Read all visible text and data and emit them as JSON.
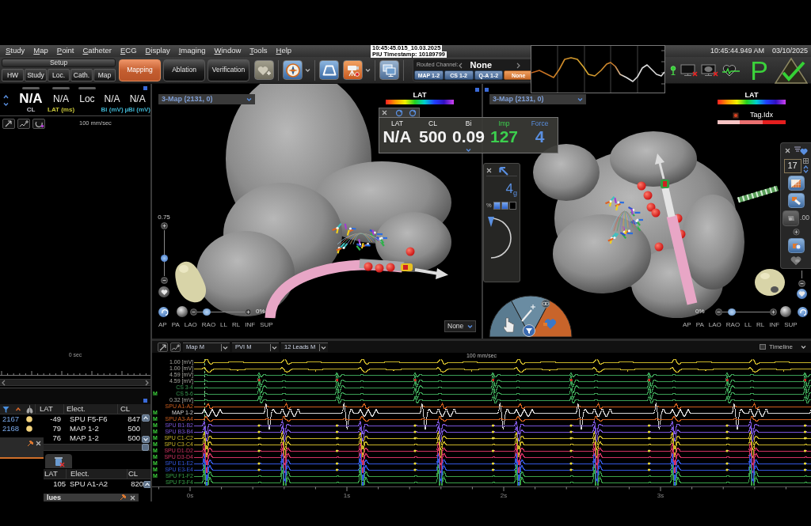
{
  "menu_bar": {
    "items": [
      "Study",
      "Map",
      "Point",
      "Catheter",
      "ECG",
      "Display",
      "Imaging",
      "Window",
      "Tools",
      "Help"
    ],
    "time": "10:45:44.949 AM",
    "date": "03/10/2025"
  },
  "timestamp_overlay": {
    "lines": [
      "10:45:45.015_10.03.2025",
      "PIU Timestamp: 10189799"
    ]
  },
  "toolbar": {
    "setup": {
      "label": "Setup",
      "buttons": [
        "HW",
        "Study",
        "Loc.",
        "Cath.",
        "Map"
      ]
    },
    "modes": [
      {
        "label": "Mapping",
        "selected": true
      },
      {
        "label": "Ablation",
        "selected": false
      },
      {
        "label": "Verification",
        "selected": false
      }
    ],
    "favorite_button": {
      "disabled": true
    },
    "routed_channel": {
      "label": "Routed Channel:",
      "value": "None",
      "channels": [
        {
          "label": "MAP 1-2",
          "selected": false
        },
        {
          "label": "CS 1-2",
          "selected": false
        },
        {
          "label": "Q-A 1-2",
          "selected": false
        },
        {
          "label": "None",
          "selected": true
        }
      ]
    },
    "status_letter": "P"
  },
  "left_panel": {
    "readouts": [
      {
        "kind": "main",
        "bar": true,
        "value": "N/A",
        "caption": "CL",
        "color": "#c9c9d2"
      },
      {
        "kind": "small",
        "bar": true,
        "value": "N/A",
        "caption": "LAT (ms)",
        "color": "#c6c43a"
      },
      {
        "kind": "small",
        "bar": true,
        "value": "Loc"
      },
      {
        "kind": "small",
        "bar": false,
        "value": "N/A",
        "caption": "Bi (mV)",
        "color": "#3fb3cf"
      },
      {
        "kind": "small",
        "bar": false,
        "value": "N/A",
        "caption": "µBi (mV)",
        "color": "#3fb3cf"
      }
    ],
    "speed": "100 mm/sec",
    "time_label": "0 sec"
  },
  "points_table": {
    "columns": [
      "LAT",
      "Elect.",
      "CL"
    ],
    "rows": [
      {
        "id": "2167",
        "color": "#f2d27c",
        "lat": "-49",
        "electrode": "SPU F5-F6",
        "cl": "847"
      },
      {
        "id": "2168",
        "color": "#f2d27c",
        "lat": "79",
        "electrode": "MAP 1-2",
        "cl": "500"
      },
      {
        "lat": "76",
        "electrode": "MAP 1-2",
        "cl": "500"
      }
    ]
  },
  "second_table": {
    "columns": [
      "LAT",
      "Elect.",
      "CL"
    ],
    "rows": [
      {
        "lat": "105",
        "electrode": "SPU A1-A2",
        "cl": "820"
      }
    ]
  },
  "bottom_panel": {
    "title": "lues"
  },
  "map_views": [
    {
      "dropdown": "3-Map (2131, 0)",
      "legends": [
        {
          "kind": "rainbow",
          "label": "LAT"
        }
      ],
      "zoom_label": "0.75",
      "zoom_slider": {
        "level": 0.36
      },
      "transparency": {
        "label": "0%",
        "level": 0.13
      },
      "view_buttons": [
        "AP",
        "PA",
        "LAO",
        "RAO",
        "LL",
        "RL",
        "INF",
        "SUP"
      ],
      "overlay_dropdown": "None"
    },
    {
      "dropdown": "3-Map (2131, 0)",
      "legends": [
        {
          "kind": "rainbow",
          "label": "LAT"
        },
        {
          "kind": "tag",
          "label": "Tag.Idx"
        }
      ],
      "transparency": {
        "label": "0%",
        "level": 0.15
      },
      "view_buttons": [
        "AP",
        "PA",
        "LAO",
        "RAO",
        "LL",
        "RL",
        "INF",
        "SUP"
      ],
      "side_toolbar": {
        "count": "17",
        "value": ".00"
      }
    }
  ],
  "catheter_readouts": [
    {
      "label": "LAT",
      "value": "N/A",
      "color": "#f2f2f2"
    },
    {
      "label": "CL",
      "value": "500",
      "color": "#f2f2f2"
    },
    {
      "label": "Bi",
      "value": "0.09",
      "color": "#f2f2f2"
    },
    {
      "label": "Imp",
      "value": "127",
      "color": "#3ccf4e"
    },
    {
      "label": "Force",
      "value": "4",
      "color": "#5a8fe0"
    }
  ],
  "force_panel": {
    "value": "4",
    "unit": "g",
    "percent_label": "%",
    "segments": [
      {
        "on": true
      },
      {
        "on": true
      },
      {
        "on": false
      }
    ]
  },
  "ecg_panel": {
    "dropdowns": [
      "Map M",
      "PVI M",
      "12 Leads M"
    ],
    "timeline": "Timeline",
    "speed": "100 mm/sec",
    "time_ticks": [
      "0s",
      "1s",
      "2s",
      "3s"
    ],
    "channels": [
      {
        "kind": "scale",
        "label": "1.00 [mV]",
        "color": "#c8b42a"
      },
      {
        "kind": "scale",
        "label": "1.00 [mV]",
        "color": "#c8b42a"
      },
      {
        "kind": "scale",
        "label": "4.59 [mV]",
        "color": "#3b9e55"
      },
      {
        "kind": "scale",
        "label": "4.59 [mV]",
        "color": "#3b9e55"
      },
      {
        "kind": "channel",
        "label": "CS 3-4",
        "color": "#3b9e55"
      },
      {
        "kind": "channel",
        "label": "CS 5-6",
        "color": "#3b9e55",
        "marker": "M"
      },
      {
        "kind": "scale",
        "label": "0.32 [mV]",
        "color": "#3b9e55"
      },
      {
        "kind": "channel",
        "label": "SPU A1-A2",
        "color": "#d0601e"
      },
      {
        "kind": "channel",
        "label": "MAP 1-2",
        "color": "#d8d8d8",
        "marker": "M"
      },
      {
        "kind": "channel",
        "label": "SPU A3-A4",
        "color": "#d0601e",
        "marker": "M"
      },
      {
        "kind": "channel",
        "label": "SPU B1-B2",
        "color": "#7a55d8",
        "marker": "M"
      },
      {
        "kind": "channel",
        "label": "SPU B3-B4",
        "color": "#7a55d8",
        "marker": "M"
      },
      {
        "kind": "channel",
        "label": "SPU C1-C2",
        "color": "#c8b428",
        "marker": "M"
      },
      {
        "kind": "channel",
        "label": "SPU C3-C4",
        "color": "#c8b428",
        "marker": "M"
      },
      {
        "kind": "channel",
        "label": "SPU D1-D2",
        "color": "#d03262",
        "marker": "M"
      },
      {
        "kind": "channel",
        "label": "SPU D3-D4",
        "color": "#d03262",
        "marker": "M"
      },
      {
        "kind": "channel",
        "label": "SPU E1-E2",
        "color": "#3458e0",
        "marker": "M"
      },
      {
        "kind": "channel",
        "label": "SPU E3-E4",
        "color": "#3458e0",
        "marker": "M"
      },
      {
        "kind": "channel",
        "label": "SPU F1-F2",
        "color": "#3aa24a",
        "marker": "M"
      },
      {
        "kind": "channel",
        "label": "SPU F3-F4",
        "color": "#3aa24a"
      }
    ]
  }
}
